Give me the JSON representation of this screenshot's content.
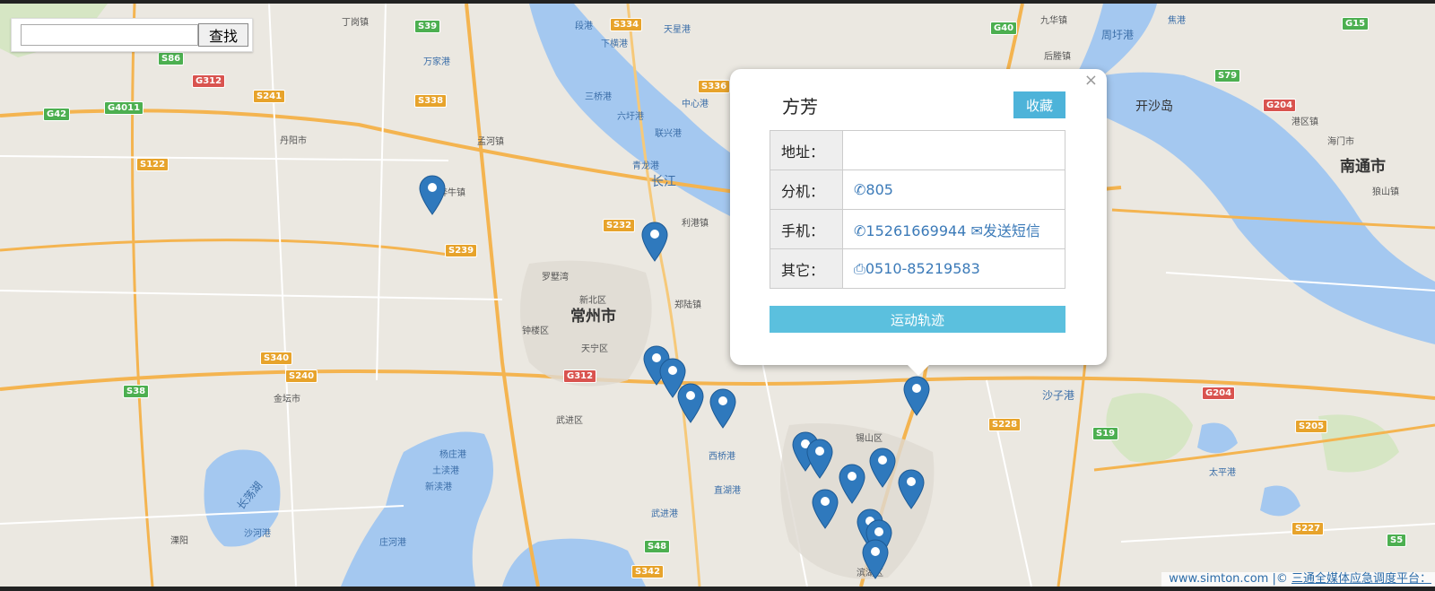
{
  "search": {
    "value": "",
    "button_label": "查找"
  },
  "map_labels": {
    "cities": [
      "常州市",
      "南通市"
    ],
    "places": [
      "开沙岛",
      "长江",
      "长荡湖",
      "沙河港",
      "杨庄港",
      "土渎港",
      "新渎港",
      "庄河港",
      "武进港",
      "直湖港",
      "太平港",
      "万家港",
      "段港",
      "天星港",
      "下横港",
      "三桥港",
      "六圩港",
      "中心港",
      "联兴港",
      "青龙港",
      "利港镇",
      "新北区",
      "天宁区",
      "钟楼区",
      "武进区",
      "西桥港",
      "锡山区",
      "沙子港",
      "滨湖区",
      "丹阳市",
      "金坛市",
      "奔牛镇",
      "罗墅湾",
      "溧阳",
      "郑陆镇",
      "孟河镇",
      "丁岗镇",
      "后塍镇",
      "周圩港",
      "九华镇",
      "焦港",
      "港区镇",
      "海门市",
      "狼山镇"
    ],
    "road_shields": [
      {
        "t": "S39",
        "c": "g"
      },
      {
        "t": "S334",
        "c": "s"
      },
      {
        "t": "G40",
        "c": "g"
      },
      {
        "t": "G15",
        "c": "g"
      },
      {
        "t": "S86",
        "c": "g"
      },
      {
        "t": "G312",
        "c": "r"
      },
      {
        "t": "G42",
        "c": "g"
      },
      {
        "t": "G4011",
        "c": "g"
      },
      {
        "t": "S241",
        "c": "s"
      },
      {
        "t": "S338",
        "c": "s"
      },
      {
        "t": "S336",
        "c": "s"
      },
      {
        "t": "S122",
        "c": "s"
      },
      {
        "t": "S239",
        "c": "s"
      },
      {
        "t": "S232",
        "c": "s"
      },
      {
        "t": "G312",
        "c": "r"
      },
      {
        "t": "S340",
        "c": "s"
      },
      {
        "t": "S240",
        "c": "s"
      },
      {
        "t": "S38",
        "c": "g"
      },
      {
        "t": "S48",
        "c": "g"
      },
      {
        "t": "S342",
        "c": "s"
      },
      {
        "t": "S228",
        "c": "s"
      },
      {
        "t": "S19",
        "c": "g"
      },
      {
        "t": "G204",
        "c": "r"
      },
      {
        "t": "S205",
        "c": "s"
      },
      {
        "t": "S227",
        "c": "s"
      },
      {
        "t": "S5",
        "c": "g"
      },
      {
        "t": "S79",
        "c": "g"
      },
      {
        "t": "G204",
        "c": "r"
      }
    ]
  },
  "popup": {
    "name": "方芳",
    "favorite_label": "收藏",
    "close_symbol": "×",
    "rows": {
      "address_key": "地址：",
      "address_value": "",
      "ext_key": "分机：",
      "ext_value": "805",
      "mobile_key": "手机：",
      "mobile_value": "15261669944",
      "sms_label": "发送短信",
      "other_key": "其它：",
      "other_value": "0510-85219583"
    },
    "track_label": "运动轨迹"
  },
  "attribution": {
    "site": "www.simton.com",
    "sep": "|©",
    "platform": "三通全媒体应急调度平台："
  },
  "colors": {
    "marker": "#2f79bd",
    "button": "#5bc0de",
    "water": "#a4c8f0",
    "land": "#ebe8e1"
  }
}
